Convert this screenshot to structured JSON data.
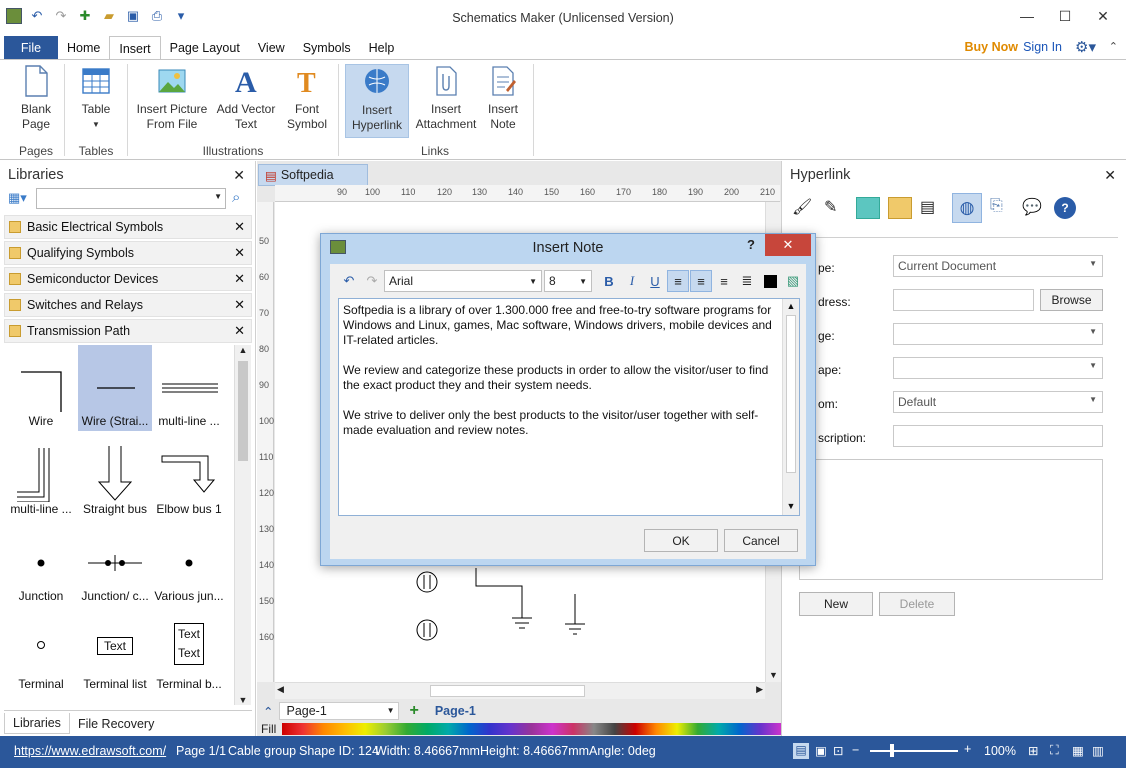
{
  "window": {
    "title": "Schematics Maker (Unlicensed Version)"
  },
  "header": {
    "buy_now": "Buy Now",
    "sign_in": "Sign In"
  },
  "tabs": [
    "File",
    "Home",
    "Insert",
    "Page Layout",
    "View",
    "Symbols",
    "Help"
  ],
  "ribbon": {
    "blank_page": "Blank\nPage",
    "table": "Table",
    "insert_picture": "Insert Picture\nFrom File",
    "add_vector_text": "Add Vector\nText",
    "font_symbol": "Font\nSymbol",
    "insert_hyperlink": "Insert\nHyperlink",
    "insert_attachment": "Insert\nAttachment",
    "insert_note": "Insert\nNote",
    "groups": {
      "pages": "Pages",
      "tables": "Tables",
      "illustrations": "Illustrations",
      "links": "Links"
    }
  },
  "libraries": {
    "title": "Libraries",
    "categories": [
      "Basic Electrical Symbols",
      "Qualifying Symbols",
      "Semiconductor Devices",
      "Switches and Relays",
      "Transmission Path"
    ],
    "shapes": [
      "Wire",
      "Wire (Strai...",
      "multi-line ...",
      "multi-line ...",
      "Straight bus",
      "Elbow bus 1",
      "Junction",
      "Junction/ c...",
      "Various jun...",
      "Terminal",
      "Terminal list",
      "Terminal b..."
    ],
    "text_shape": "Text",
    "bottom_tabs": [
      "Libraries",
      "File Recovery"
    ]
  },
  "document": {
    "tab": "Softpedia",
    "page_tab": "Page-1",
    "page_link": "Page-1",
    "fill_label": "Fill",
    "ruler_h": [
      "90",
      "100",
      "110",
      "120",
      "130",
      "140",
      "150",
      "160",
      "170",
      "180",
      "190",
      "200",
      "210"
    ],
    "ruler_v": [
      "50",
      "60",
      "70",
      "80",
      "90",
      "100",
      "110",
      "120",
      "130",
      "140",
      "150",
      "160"
    ]
  },
  "hyperlink_panel": {
    "title": "Hyperlink",
    "labels": [
      "pe:",
      "dress:",
      "ge:",
      "ape:",
      "om:",
      "scription:"
    ],
    "type_value": "Current Document",
    "zoom_value": "Default",
    "browse": "Browse",
    "new": "New",
    "delete": "Delete"
  },
  "dialog": {
    "title": "Insert Note",
    "help": "?",
    "font": "Arial",
    "size": "8",
    "paragraphs": [
      "Softpedia is a library of over 1.300.000 free and free-to-try software programs for Windows and Linux, games, Mac software, Windows drivers, mobile devices and IT-related articles.",
      "We review and categorize these products in order to allow the visitor/user to find the exact product they and their system needs.",
      "We strive to deliver only the best products to the visitor/user together with self-made evaluation and review notes."
    ],
    "ok": "OK",
    "cancel": "Cancel"
  },
  "status": {
    "url": "https://www.edrawsoft.com/",
    "page": "Page 1/1",
    "group": "Cable group",
    "shape_id": "Shape ID: 124",
    "width": "Width: 8.46667mm",
    "height": "Height: 8.46667mm",
    "angle": "Angle: 0deg",
    "zoom": "100%"
  },
  "colors": {
    "accent": "#2b579a",
    "buy_now": "#e08a00",
    "selected": "#c6d9ef"
  }
}
